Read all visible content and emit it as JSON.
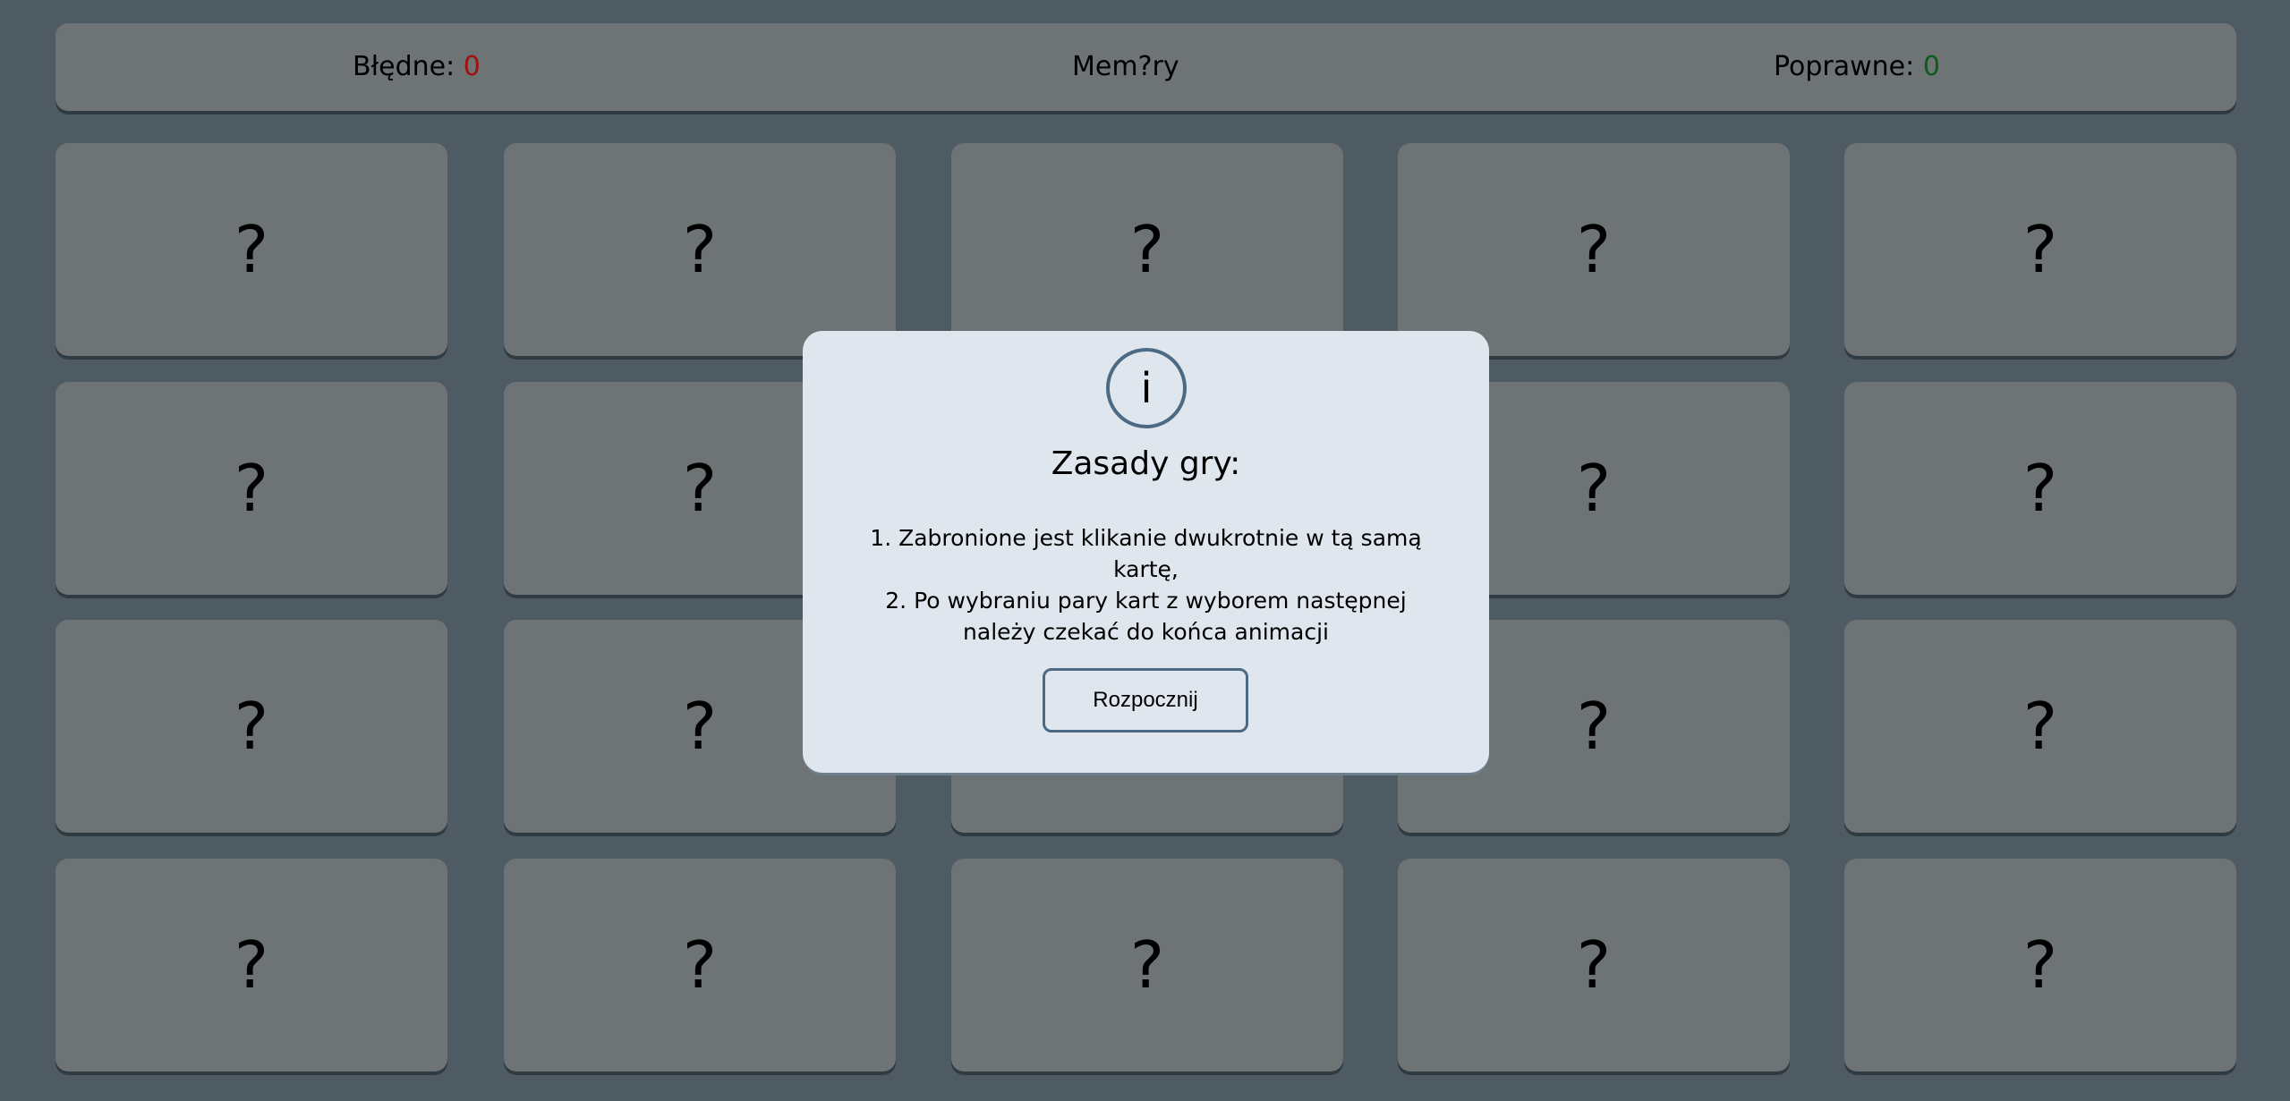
{
  "header": {
    "wrong_label": "Błędne:",
    "wrong_count": "0",
    "title": "Mem?ry",
    "correct_label": "Poprawne:",
    "correct_count": "0"
  },
  "card_mark": "?",
  "modal": {
    "icon_glyph": "i",
    "title": "Zasady gry:",
    "rules": [
      "1. Zabronione jest klikanie dwukrotnie w tą samą kartę,",
      "2. Po wybraniu pary kart z wyborem następnej należy czekać do końca animacji"
    ],
    "start_button_label": "Rozpocznij"
  },
  "colors": {
    "background": "#4f5b63",
    "panel": "#6e7376",
    "modal": "#dfe6ed",
    "accent": "#4d6a85",
    "wrong": "#a01010",
    "correct": "#0f5a1a"
  },
  "grid": {
    "rows": 4,
    "columns": 5
  }
}
